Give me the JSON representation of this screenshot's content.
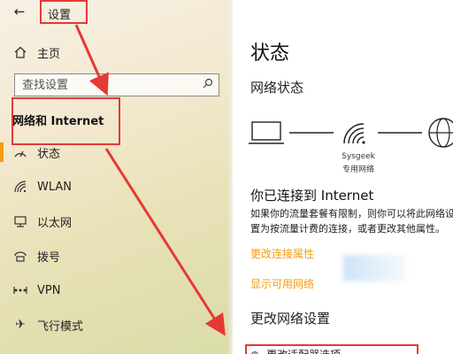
{
  "window": {
    "back_icon": "back-arrow-icon",
    "title": "设置"
  },
  "sidebar": {
    "home": {
      "label": "主页",
      "icon": "home-icon"
    },
    "search": {
      "placeholder": "查找设置",
      "icon": "search-icon"
    },
    "category": "网络和 Internet",
    "items": [
      {
        "label": "状态",
        "icon": "status-icon",
        "active": true
      },
      {
        "label": "WLAN",
        "icon": "wifi-icon"
      },
      {
        "label": "以太网",
        "icon": "ethernet-icon"
      },
      {
        "label": "拨号",
        "icon": "dialup-icon"
      },
      {
        "label": "VPN",
        "icon": "vpn-icon"
      },
      {
        "label": "飞行模式",
        "icon": "airplane-icon"
      }
    ],
    "accent_color": "#f39c12"
  },
  "main": {
    "heading": "状态",
    "network_status_heading": "网络状态",
    "network_name": "Sysgeek",
    "network_type": "专用网络",
    "connected_title": "你已连接到 Internet",
    "connected_desc": "如果你的流量套餐有限制，则你可以将此网络设置为按流量计费的连接，或者更改其他属性。",
    "change_connection_props": "更改连接属性",
    "show_networks": "显示可用网络",
    "change_settings_heading": "更改网络设置",
    "adapter_options": "更改适配器选项"
  },
  "annotation_color": "#e53935"
}
